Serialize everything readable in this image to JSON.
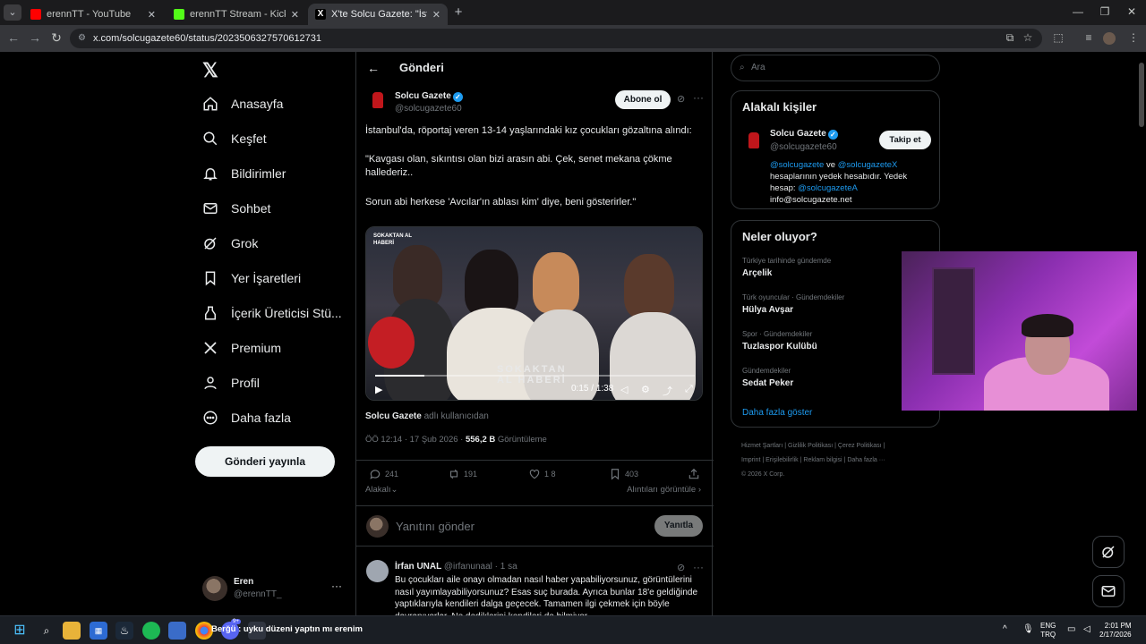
{
  "browser": {
    "tabs": [
      {
        "title": "erennTT - YouTube",
        "color": "#ff0000"
      },
      {
        "title": "erennTT Stream - Kick Dashboard",
        "color": "#53fc18"
      },
      {
        "title": "X'te Solcu Gazete: \"İstanbul'da, röportaj",
        "color": "#ffffff"
      }
    ],
    "url": "x.com/solcugazete60/status/2023506327570612731"
  },
  "nav": {
    "items": [
      {
        "label": "Anasayfa",
        "icon": "home-icon"
      },
      {
        "label": "Keşfet",
        "icon": "search-icon"
      },
      {
        "label": "Bildirimler",
        "icon": "bell-icon"
      },
      {
        "label": "Sohbet",
        "icon": "mail-icon"
      },
      {
        "label": "Grok",
        "icon": "grok-icon"
      },
      {
        "label": "Yer İşaretleri",
        "icon": "bookmark-icon"
      },
      {
        "label": "İçerik Üreticisi Stü...",
        "icon": "creator-icon"
      },
      {
        "label": "Premium",
        "icon": "x-logo-icon"
      },
      {
        "label": "Profil",
        "icon": "user-icon"
      },
      {
        "label": "Daha fazla",
        "icon": "more-circle-icon"
      }
    ],
    "post_button": "Gönderi yayınla",
    "account": {
      "name": "Eren",
      "handle": "@erennTT_"
    }
  },
  "main": {
    "header": "Gönderi",
    "tweet": {
      "name": "Solcu Gazete",
      "handle": "@solcugazete60",
      "subscribe": "Abone ol",
      "text1": "İstanbul'da, röportaj veren 13-14 yaşlarındaki kız çocukları gözaltına alındı:",
      "text2": "\"Kavgası olan, sıkıntısı olan bizi arasın abi. Çek, senet mekana çökme hallederiz..",
      "text3": "Sorun abi herkese 'Avcılar'ın ablası kim' diye, beni gösterirler.\"",
      "video": {
        "label_small": "SOKAKTAN AL HABERİ",
        "logo": "SOKAKTAN AL HABERİ",
        "time": "0:15 / 1:38",
        "progress": 0.153
      },
      "source_name": "Solcu Gazete",
      "source_suffix": "adlı kullanıcıdan",
      "time": "ÖÖ 12:14 · 17 Şub 2026 ·",
      "views": "556,2 B",
      "views_label": "Görüntüleme",
      "stats": {
        "replies": "241",
        "reposts": "191",
        "likes": "1 8",
        "bookmarks": "403"
      },
      "sort": "Alakalı",
      "quotes": "Alıntıları görüntüle"
    },
    "reply_placeholder": "Yanıtını gönder",
    "reply_button": "Yanıtla",
    "reply": {
      "name": "İrfan UNAL",
      "handle": "@irfanunaal · 1 sa",
      "text": "Bu çocukları aile onayı olmadan nasıl haber yapabiliyorsunuz, görüntülerini nasıl yayımlayabiliyorsunuz? Esas suç burada. Ayrıca bunlar 18'e geldiğinde yaptıklarıyla kendileri dalga geçecek. Tamamen ilgi çekmek için böyle davranıyorlar. Ne dediklerini kendileri de bilmiyor."
    }
  },
  "right": {
    "search_placeholder": "Ara",
    "related": {
      "title": "Alakalı kişiler",
      "name": "Solcu Gazete",
      "handle": "@solcugazete60",
      "follow": "Takip et",
      "bio_link1": "@solcugazete",
      "bio_and": "ve",
      "bio_link2": "@solcugazeteX",
      "bio_text": "hesaplarının yedek hesabıdır. Yedek hesap:",
      "bio_link3": "@solcugazeteA",
      "bio_email": "info@solcugazete.net"
    },
    "trends": {
      "title": "Neler oluyor?",
      "items": [
        {
          "context": "Türkiye tarihinde gündemde",
          "name": "Arçelik"
        },
        {
          "context": "Türk oyuncular · Gündemdekiler",
          "name": "Hülya Avşar"
        },
        {
          "context": "Spor · Gündemdekiler",
          "name": "Tuzlaspor Kulübü"
        },
        {
          "context": "Gündemdekiler",
          "name": "Sedat Peker"
        }
      ],
      "show_more": "Daha fazla göster"
    },
    "footer": [
      "Hizmet Şartları",
      "Gizlilik Politikası",
      "Çerez Politikası",
      "Imprint",
      "Erişilebilirlik",
      "Reklam bilgisi",
      "Daha fazla ···",
      "© 2026 X Corp."
    ]
  },
  "taskbar": {
    "notification_text": "Berğü : uyku düzeni yaptın mı erenim",
    "badge": "9+",
    "lang": "ENG",
    "region": "TRQ",
    "time": "2:01 PM",
    "date": "2/17/2026"
  }
}
